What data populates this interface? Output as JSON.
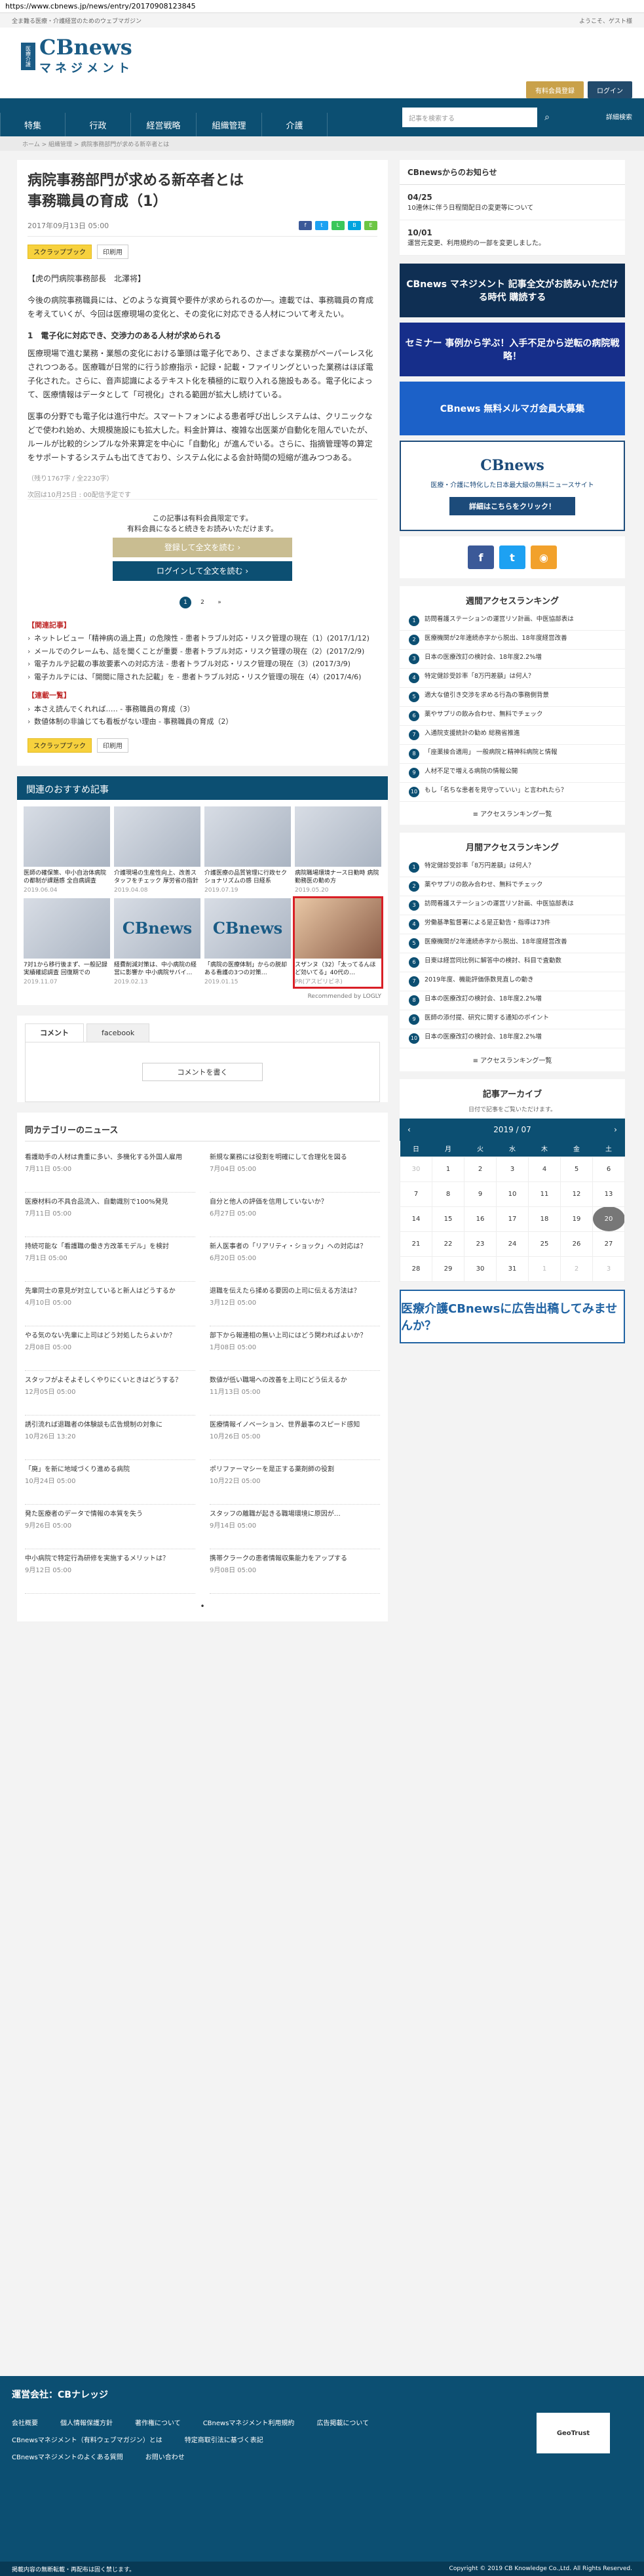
{
  "url": "https://www.cbnews.jp/news/entry/20170908123845",
  "tagline": "全ま難る医療・介護経営のためのウェブマガジン",
  "welcome": "ようこそ、ゲスト様",
  "logo": {
    "main": "CBnews",
    "sub": "マネジメント",
    "badge": "医療介護"
  },
  "header_buttons": [
    "有料会員登録",
    "ログイン"
  ],
  "nav": [
    "特集",
    "行政",
    "経営戦略",
    "組織管理",
    "介護"
  ],
  "search_placeholder": "記事を検索する",
  "detail_search": "詳細検索",
  "breadcrumb": "ホーム > 組織管理 > 病院事務部門が求める新卒者とは",
  "article": {
    "title": "病院事務部門が求める新卒者とは\n事務職員の育成（1）",
    "date": "2017年09月13日 05:00",
    "tags": [
      "スクラップブック",
      "印刷用"
    ],
    "author": "【虎の門病院事務部長　北澤将】",
    "paragraphs": [
      "今後の病院事務職員には、どのような資質や要件が求められるのか―。連載では、事務職員の育成を考えていくが、今回は医療現場の変化と、その変化に対応できる人材について考えたい。",
      "医療現場で進む業務・業態の変化における筆頭は電子化であり、さまざまな業務がペーパーレス化されつつある。医療職が日常的に行う診療指示・記録・記載・ファイリングといった業務はほぼ電子化された。さらに、音声認識によるテキスト化を積極的に取り入れる施設もある。電子化によって、医療情報はデータとして「可視化」される範囲が拡大し続けている。",
      "医事の分野でも電子化は進行中だ。スマートフォンによる患者呼び出しシステムは、クリニックなどで使われ始め、大規模施設にも拡大した。料金計算は、複雑な出医薬が自動化を阻んでいたが、ルールが比較的シンプルな外来算定を中心に「自動化」が進んでいる。さらに、指摘管理等の算定をサポートするシステムも出てきており、システム化による会計時間の短縮が進みつつある。"
    ],
    "heading1": "1　電子化に対応でき、交渉力のある人材が求められる",
    "count": "（残り1767字 / 全2230字）",
    "next": "次回は10月25日 : 00配信予定です",
    "member_text1": "この記事は有料会員限定です。",
    "member_text2": "有料会員になると続きをお読みいただけます。",
    "btn_register": "登録して全文を読む ›",
    "btn_login": "ログインして全文を読む ›",
    "pages": [
      "1",
      "2",
      "»"
    ]
  },
  "related_title": "【関連記事】",
  "related": [
    "ネットレビュー「精神病の過上貫」の危険性 - 患者トラブル対応・リスク管理の現在（1）(2017/1/12)",
    "メールでのクレームも、話を聞くことが重要 - 患者トラブル対応・リスク管理の現在（2）(2017/2/9)",
    "電子カルテ記載の事故要素への対応方法 - 患者トラブル対応・リスク管理の現在（3）(2017/3/9)",
    "電子カルテには、「開閲に隠された記載」を - 患者トラブル対応・リスク管理の現在（4）(2017/4/6)"
  ],
  "series_title": "【連載一覧】",
  "series": [
    "本さえ読んでくれれば…‥ - 事務職員の育成（3）",
    "数値体制の非論じても看板がない理由 - 事務職員の育成（2）"
  ],
  "reco_title": "関連のおすすめ記事",
  "reco": [
    {
      "title": "医師の確保策、中小自治体病院の都制が課題感 全自病調査",
      "date": "2019.06.04"
    },
    {
      "title": "介護現場の生産性向上、改善スタッフをチェック 厚労省の指針",
      "date": "2019.04.08"
    },
    {
      "title": "介護医療の品質管理に行政セクショナリズムの感 日経系",
      "date": "2019.07.19"
    },
    {
      "title": "病院職場環境ナース日勤時 病院勤務医の勤め方",
      "date": "2019.05.20"
    },
    {
      "title": "7対1から移行後まず、一般記録実績確認調査 回復期での",
      "date": "2019.11.07"
    },
    {
      "title": "経費削減対策は、中小病院の経営に影響か 中小病院サバイ…",
      "date": "2019.02.13"
    },
    {
      "title": "「病院の医療体制」からの脱却 ある看護の3つの対策…",
      "date": "2019.01.15"
    },
    {
      "title": "スザンヌ（32）「太ってるんほど効いてる」40代の…",
      "date": "PR(アスピリビネ)"
    }
  ],
  "recommended_by": "Recommended by LOGLY",
  "tabs": [
    "コメント",
    "facebook"
  ],
  "comment_btn": "コメントを書く",
  "news_title": "同カテゴリーのニュース",
  "news": [
    {
      "t": "看護助手の人材は貴重に多い、多機化する外国人雇用",
      "d": "7月11日 05:00"
    },
    {
      "t": "新規な業務には役割を明確にして合理化を図る",
      "d": "7月04日 05:00"
    },
    {
      "t": "医療材料の不具合品流入、自動識別で100%発見",
      "d": "7月11日 05:00"
    },
    {
      "t": "自分と他人の評価を信用していないか？",
      "d": "6月27日 05:00"
    },
    {
      "t": "持続可能な「看護職の働き方改革モデル」を検討",
      "d": "7月1日 05:00"
    },
    {
      "t": "新人医事者の「リアリティ・ショック」への対応は？",
      "d": "6月20日 05:00"
    },
    {
      "t": "先輩同士の意見が対立していると新人はどうするか",
      "d": "4月10日 05:00"
    },
    {
      "t": "退職を伝えたら揉める要因の上司に伝える方法は？",
      "d": "3月12日 05:00"
    },
    {
      "t": "やる気のない先輩に上司はどう対処したらよいか？",
      "d": "2月08日 05:00"
    },
    {
      "t": "部下から報連相の無い上司にはどう関わればよいか？",
      "d": "1月08日 05:00"
    },
    {
      "t": "スタッフがよそよそしくやりにくいときはどうする？",
      "d": "12月05日 05:00"
    },
    {
      "t": "数値が低い職場への改善を上司にどう伝えるか",
      "d": "11月13日 05:00"
    },
    {
      "t": "誘引流れば退職者の体験談も広告規制の対象に",
      "d": "10月26日 13:20"
    },
    {
      "t": "医療情報イノベーション、世界最事のスピード感知",
      "d": "10月26日 05:00"
    },
    {
      "t": "「廃」を新に地域づくり進める病院",
      "d": "10月24日 05:00"
    },
    {
      "t": "ポリファーマシーを是正する薬剤師の役割",
      "d": "10月22日 05:00"
    },
    {
      "t": "発た医療者のデータで情報の本質を失う",
      "d": "9月26日 05:00"
    },
    {
      "t": "スタッフの離職が起きる職場環境に原因が…",
      "d": "9月14日 05:00"
    },
    {
      "t": "中小病院で特定行為研修を実施するメリットは？",
      "d": "9月12日 05:00"
    },
    {
      "t": "携帯クラークの患者情報収集能力をアップする",
      "d": "9月08日 05:00"
    }
  ],
  "side": {
    "notice_title": "CBnewsからのお知らせ",
    "notices": [
      {
        "d": "04/25",
        "t": "10連休に伴う日程間配日の変更等について"
      },
      {
        "d": "10/01",
        "t": "運営元変更、利用規約の一部を変更しました。"
      }
    ],
    "banners": [
      "CBnews マネジメント 記事全文がお読みいただける時代 購読する",
      "セミナー 事例から学ぶ！入手不足から逆転の病院戦略！",
      "CBnews 無料メルマガ会員大募集",
      "医療・介護に特化した日本最大級の無料ニュースサイト"
    ],
    "banner4_cta": "詳細はこちらをクリック！",
    "ranking_weekly": "週間アクセスランキング",
    "weekly": [
      "訪問看護ステーションの運営リソ計画、中医協部表は",
      "医療機関が2年連続赤字から脱出、18年度経営改善",
      "日本の医療改訂の検討会、18年度2.2%増",
      "特定健診受診率「8万円差額」は何人？",
      "適大な値引き交渉を求める行為の事務側背景",
      "薬やサプリの飲み合わせ、無料でチェック",
      "入通院支援統計の勧め 総務省推進",
      "「座薬接合適用」 一般病院と精神科病院と情報",
      "人材不足で増える病院の情報公開",
      "もし「名ちな患者を見守っていい」と言われたら？"
    ],
    "ranking_monthly": "月間アクセスランキング",
    "monthly": [
      "特定健診受診率「8万円差額」は何人？",
      "薬やサプリの飲み合わせ、無料でチェック",
      "訪問看護ステーションの運営リソ計画、中医協部表は",
      "労働基準監督署による是正勧告・指導は73件",
      "医療機関が2年連続赤字から脱出、18年度経営改善",
      "日東は経営同比例に解答中の検討、科目で査動数",
      "2019年度、機能評価係数見直しの動き",
      "日本の医療改訂の検討会、18年度2.2%増",
      "医師の添付提、研究に関する通知のポイント",
      "日本の医療改訂の検討会、18年度2.2%増"
    ],
    "more": "≡ アクセスランキング一覧",
    "archive": "記事アーカイブ",
    "archive_note": "日付で記事をご覧いただけます。",
    "month": "2019 / 07",
    "week": [
      "日",
      "月",
      "火",
      "水",
      "木",
      "金",
      "土"
    ],
    "days": [
      [
        "30",
        "1",
        "2",
        "3",
        "4",
        "5",
        "6"
      ],
      [
        "7",
        "8",
        "9",
        "10",
        "11",
        "12",
        "13"
      ],
      [
        "14",
        "15",
        "16",
        "17",
        "18",
        "19",
        "20"
      ],
      [
        "21",
        "22",
        "23",
        "24",
        "25",
        "26",
        "27"
      ],
      [
        "28",
        "29",
        "30",
        "31",
        "1",
        "2",
        "3"
      ]
    ],
    "ad": "医療介護CBnewsに広告出稿してみませんか？"
  },
  "footer": {
    "title": "運営会社：CBナレッジ",
    "links": [
      "会社概要",
      "個人情報保護方針",
      "著作権について",
      "CBnewsマネジメント利用規約",
      "広告掲載について",
      "CBnewsマネジメント（有料ウェブマガジン）とは",
      "特定商取引法に基づく表記",
      "CBnewsマネジメントのよくある質問",
      "お問い合わせ"
    ],
    "copy_left": "掲載内容の無断転載・再配布は固く禁じます。",
    "copy_right": "Copyright © 2019 CB Knowledge Co.,Ltd. All Rights Reserved.",
    "seal": "GeoTrust"
  }
}
